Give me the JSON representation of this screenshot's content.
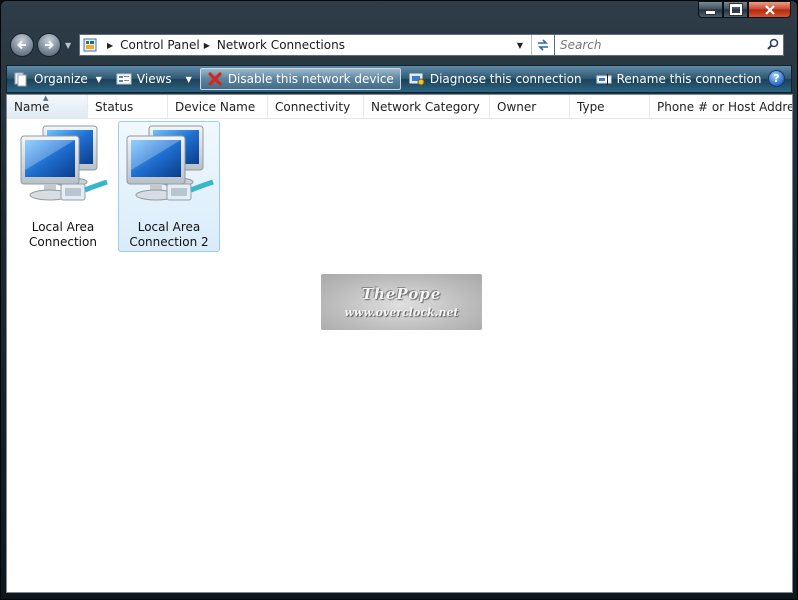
{
  "window": {
    "controls": {
      "minimize": "Minimize",
      "maximize": "Maximize",
      "close": "Close"
    }
  },
  "address_bar": {
    "breadcrumb": [
      "Control Panel",
      "Network Connections"
    ],
    "icon": "control-panel-icon"
  },
  "search": {
    "placeholder": "Search"
  },
  "toolbar": {
    "items": [
      {
        "label": "Organize",
        "icon": "organize-icon",
        "has_menu": true
      },
      {
        "label": "Views",
        "icon": "views-icon",
        "has_menu": true
      },
      {
        "label": "Disable this network device",
        "icon": "disable-x-icon",
        "pressed": true
      },
      {
        "label": "Diagnose this connection",
        "icon": "diagnose-icon"
      },
      {
        "label": "Rename this connection",
        "icon": "rename-icon"
      }
    ],
    "more": "»",
    "help": "?"
  },
  "columns": [
    {
      "label": "Name",
      "sorted": true
    },
    {
      "label": "Status"
    },
    {
      "label": "Device Name"
    },
    {
      "label": "Connectivity"
    },
    {
      "label": "Network Category"
    },
    {
      "label": "Owner"
    },
    {
      "label": "Type"
    },
    {
      "label": "Phone # or Host Addre..."
    }
  ],
  "connections": [
    {
      "line1": "Local Area",
      "line2": "Connection",
      "selected": false
    },
    {
      "line1": "Local Area",
      "line2": "Connection 2",
      "selected": true
    }
  ],
  "watermark": {
    "line1": "ThePope",
    "line2": "www.overclock.net"
  },
  "colors": {
    "toolbar": "#2f5872",
    "selection": "#d9ecfa",
    "accent": "#2d66b3"
  }
}
